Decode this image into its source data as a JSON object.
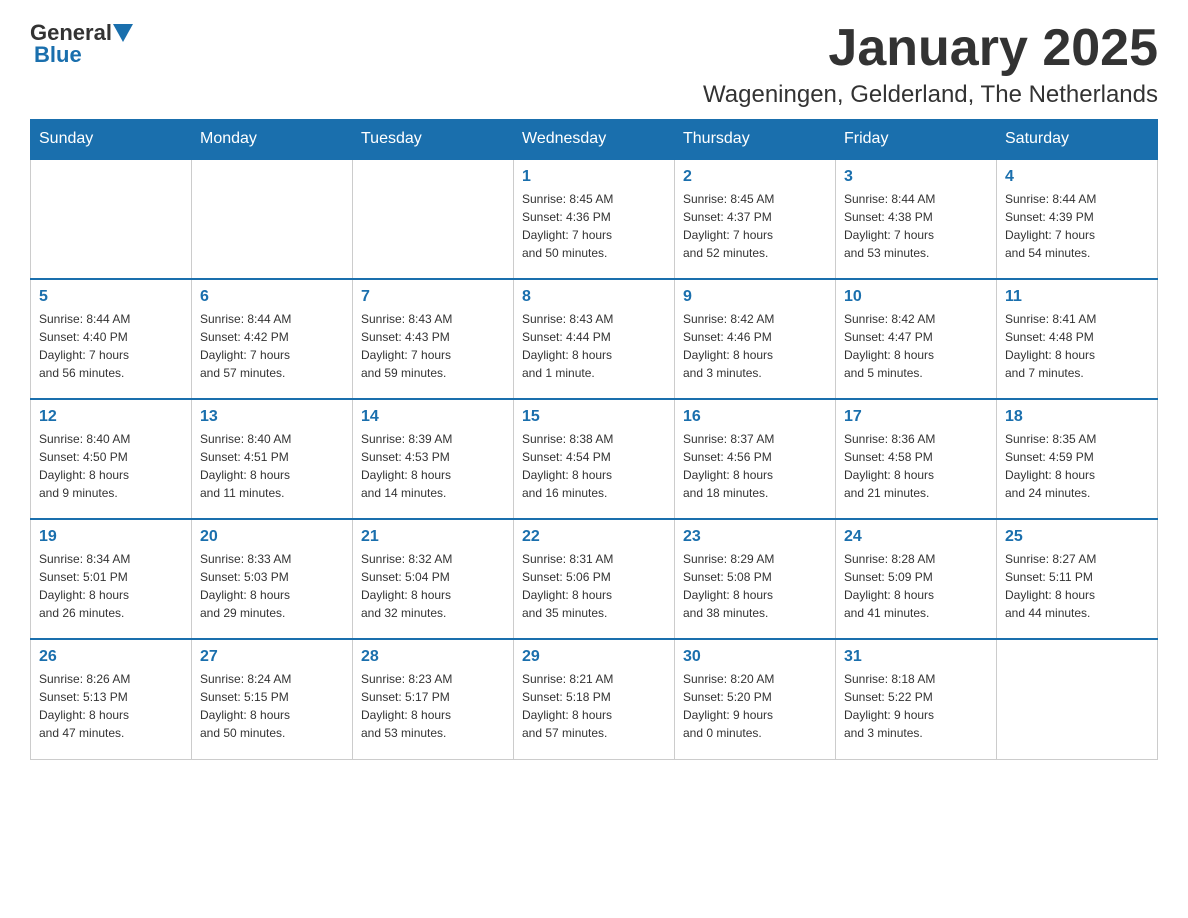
{
  "header": {
    "logo": {
      "general": "General",
      "blue": "Blue",
      "tagline": "GeneralBlue"
    },
    "title": "January 2025",
    "location": "Wageningen, Gelderland, The Netherlands"
  },
  "days_of_week": [
    "Sunday",
    "Monday",
    "Tuesday",
    "Wednesday",
    "Thursday",
    "Friday",
    "Saturday"
  ],
  "weeks": [
    {
      "days": [
        {
          "number": "",
          "info": ""
        },
        {
          "number": "",
          "info": ""
        },
        {
          "number": "",
          "info": ""
        },
        {
          "number": "1",
          "info": "Sunrise: 8:45 AM\nSunset: 4:36 PM\nDaylight: 7 hours\nand 50 minutes."
        },
        {
          "number": "2",
          "info": "Sunrise: 8:45 AM\nSunset: 4:37 PM\nDaylight: 7 hours\nand 52 minutes."
        },
        {
          "number": "3",
          "info": "Sunrise: 8:44 AM\nSunset: 4:38 PM\nDaylight: 7 hours\nand 53 minutes."
        },
        {
          "number": "4",
          "info": "Sunrise: 8:44 AM\nSunset: 4:39 PM\nDaylight: 7 hours\nand 54 minutes."
        }
      ]
    },
    {
      "days": [
        {
          "number": "5",
          "info": "Sunrise: 8:44 AM\nSunset: 4:40 PM\nDaylight: 7 hours\nand 56 minutes."
        },
        {
          "number": "6",
          "info": "Sunrise: 8:44 AM\nSunset: 4:42 PM\nDaylight: 7 hours\nand 57 minutes."
        },
        {
          "number": "7",
          "info": "Sunrise: 8:43 AM\nSunset: 4:43 PM\nDaylight: 7 hours\nand 59 minutes."
        },
        {
          "number": "8",
          "info": "Sunrise: 8:43 AM\nSunset: 4:44 PM\nDaylight: 8 hours\nand 1 minute."
        },
        {
          "number": "9",
          "info": "Sunrise: 8:42 AM\nSunset: 4:46 PM\nDaylight: 8 hours\nand 3 minutes."
        },
        {
          "number": "10",
          "info": "Sunrise: 8:42 AM\nSunset: 4:47 PM\nDaylight: 8 hours\nand 5 minutes."
        },
        {
          "number": "11",
          "info": "Sunrise: 8:41 AM\nSunset: 4:48 PM\nDaylight: 8 hours\nand 7 minutes."
        }
      ]
    },
    {
      "days": [
        {
          "number": "12",
          "info": "Sunrise: 8:40 AM\nSunset: 4:50 PM\nDaylight: 8 hours\nand 9 minutes."
        },
        {
          "number": "13",
          "info": "Sunrise: 8:40 AM\nSunset: 4:51 PM\nDaylight: 8 hours\nand 11 minutes."
        },
        {
          "number": "14",
          "info": "Sunrise: 8:39 AM\nSunset: 4:53 PM\nDaylight: 8 hours\nand 14 minutes."
        },
        {
          "number": "15",
          "info": "Sunrise: 8:38 AM\nSunset: 4:54 PM\nDaylight: 8 hours\nand 16 minutes."
        },
        {
          "number": "16",
          "info": "Sunrise: 8:37 AM\nSunset: 4:56 PM\nDaylight: 8 hours\nand 18 minutes."
        },
        {
          "number": "17",
          "info": "Sunrise: 8:36 AM\nSunset: 4:58 PM\nDaylight: 8 hours\nand 21 minutes."
        },
        {
          "number": "18",
          "info": "Sunrise: 8:35 AM\nSunset: 4:59 PM\nDaylight: 8 hours\nand 24 minutes."
        }
      ]
    },
    {
      "days": [
        {
          "number": "19",
          "info": "Sunrise: 8:34 AM\nSunset: 5:01 PM\nDaylight: 8 hours\nand 26 minutes."
        },
        {
          "number": "20",
          "info": "Sunrise: 8:33 AM\nSunset: 5:03 PM\nDaylight: 8 hours\nand 29 minutes."
        },
        {
          "number": "21",
          "info": "Sunrise: 8:32 AM\nSunset: 5:04 PM\nDaylight: 8 hours\nand 32 minutes."
        },
        {
          "number": "22",
          "info": "Sunrise: 8:31 AM\nSunset: 5:06 PM\nDaylight: 8 hours\nand 35 minutes."
        },
        {
          "number": "23",
          "info": "Sunrise: 8:29 AM\nSunset: 5:08 PM\nDaylight: 8 hours\nand 38 minutes."
        },
        {
          "number": "24",
          "info": "Sunrise: 8:28 AM\nSunset: 5:09 PM\nDaylight: 8 hours\nand 41 minutes."
        },
        {
          "number": "25",
          "info": "Sunrise: 8:27 AM\nSunset: 5:11 PM\nDaylight: 8 hours\nand 44 minutes."
        }
      ]
    },
    {
      "days": [
        {
          "number": "26",
          "info": "Sunrise: 8:26 AM\nSunset: 5:13 PM\nDaylight: 8 hours\nand 47 minutes."
        },
        {
          "number": "27",
          "info": "Sunrise: 8:24 AM\nSunset: 5:15 PM\nDaylight: 8 hours\nand 50 minutes."
        },
        {
          "number": "28",
          "info": "Sunrise: 8:23 AM\nSunset: 5:17 PM\nDaylight: 8 hours\nand 53 minutes."
        },
        {
          "number": "29",
          "info": "Sunrise: 8:21 AM\nSunset: 5:18 PM\nDaylight: 8 hours\nand 57 minutes."
        },
        {
          "number": "30",
          "info": "Sunrise: 8:20 AM\nSunset: 5:20 PM\nDaylight: 9 hours\nand 0 minutes."
        },
        {
          "number": "31",
          "info": "Sunrise: 8:18 AM\nSunset: 5:22 PM\nDaylight: 9 hours\nand 3 minutes."
        },
        {
          "number": "",
          "info": ""
        }
      ]
    }
  ]
}
